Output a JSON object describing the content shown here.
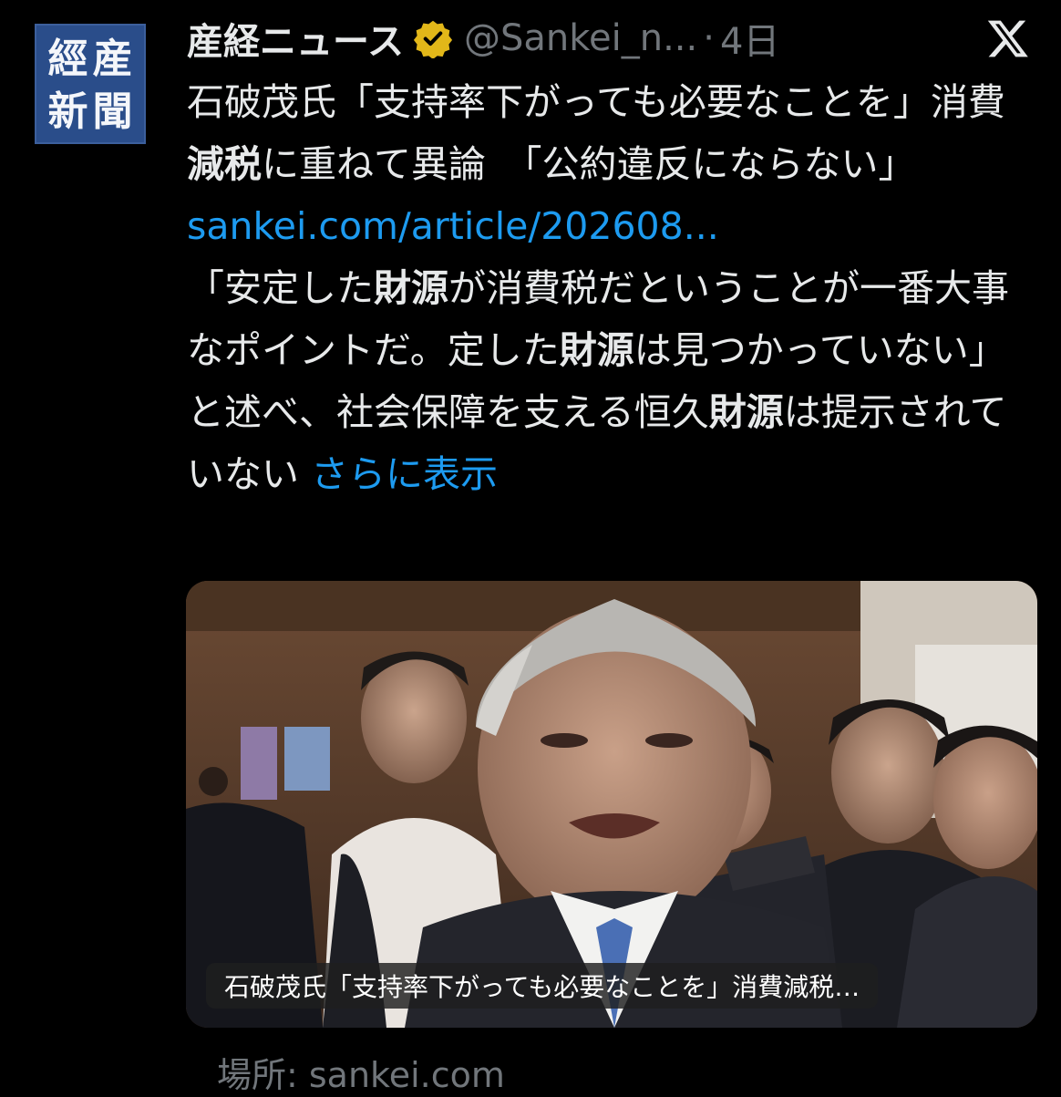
{
  "account": {
    "avatar_chars": [
      "産",
      "經",
      "新",
      "聞"
    ],
    "display_name": "産経ニュース",
    "handle": "@Sankei_n...",
    "separator": "·",
    "time": "4日",
    "verified_color": "#e2b719"
  },
  "tweet": {
    "line_parts": {
      "p1": "石破茂氏「支持率下がっても必要なことを」消費",
      "p1b": "減税",
      "p1c": "に重ねて異論　「公約違反にならない」",
      "link": "sankei.com/article/202608...",
      "p2a": "「安定した",
      "p2b": "財源",
      "p2c": "が消費税だということが一番大事なポイントだ。定した",
      "p2d": "財源",
      "p2e": "は見つかっていない」と述べ、社会保障を支える恒久",
      "p2f": "財源",
      "p2g": "は提示されていない",
      "show_more": "さらに表示"
    }
  },
  "media": {
    "caption": "石破茂氏「支持率下がっても必要なことを」消費減税…",
    "image_description_icon": "press-scrum-photo"
  },
  "source": {
    "label": "場所: sankei.com"
  },
  "colors": {
    "background": "#000000",
    "text": "#e7e9ea",
    "muted": "#71767b",
    "link": "#1d9bf0"
  },
  "icons": {
    "brand": "x-logo-icon",
    "verified": "verified-badge-icon"
  }
}
